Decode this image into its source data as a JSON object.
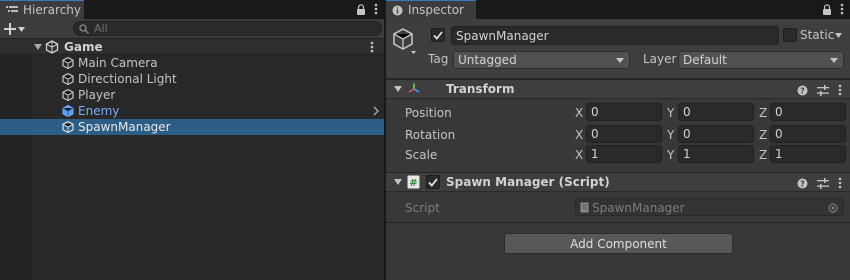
{
  "colors": {
    "accent": "#3a79bb",
    "selection": "#2c5d87",
    "prefab": "#7baaf7",
    "panel": "#383838"
  },
  "hierarchy": {
    "tab_label": "Hierarchy",
    "add_label": "+",
    "search_placeholder": "All",
    "scene": {
      "name": "Game",
      "icon": "unity-scene-icon"
    },
    "items": [
      {
        "name": "Main Camera",
        "icon": "gameobject-icon",
        "prefab": false,
        "selected": false
      },
      {
        "name": "Directional Light",
        "icon": "gameobject-icon",
        "prefab": false,
        "selected": false
      },
      {
        "name": "Player",
        "icon": "gameobject-icon",
        "prefab": false,
        "selected": false
      },
      {
        "name": "Enemy",
        "icon": "prefab-icon",
        "prefab": true,
        "selected": false
      },
      {
        "name": "SpawnManager",
        "icon": "gameobject-icon",
        "prefab": false,
        "selected": true
      }
    ]
  },
  "inspector": {
    "tab_label": "Inspector",
    "object": {
      "name": "SpawnManager",
      "active": true,
      "static_label": "Static",
      "static": false,
      "tag_label": "Tag",
      "tag_value": "Untagged",
      "layer_label": "Layer",
      "layer_value": "Default"
    },
    "transform": {
      "title": "Transform",
      "rows": [
        {
          "label": "Position",
          "x": "0",
          "y": "0",
          "z": "0"
        },
        {
          "label": "Rotation",
          "x": "0",
          "y": "0",
          "z": "0"
        },
        {
          "label": "Scale",
          "x": "1",
          "y": "1",
          "z": "1"
        }
      ],
      "axis_labels": {
        "x": "X",
        "y": "Y",
        "z": "Z"
      }
    },
    "script_component": {
      "title": "Spawn Manager (Script)",
      "enabled": true,
      "script_label": "Script",
      "script_value": "SpawnManager"
    },
    "add_component_label": "Add Component"
  }
}
